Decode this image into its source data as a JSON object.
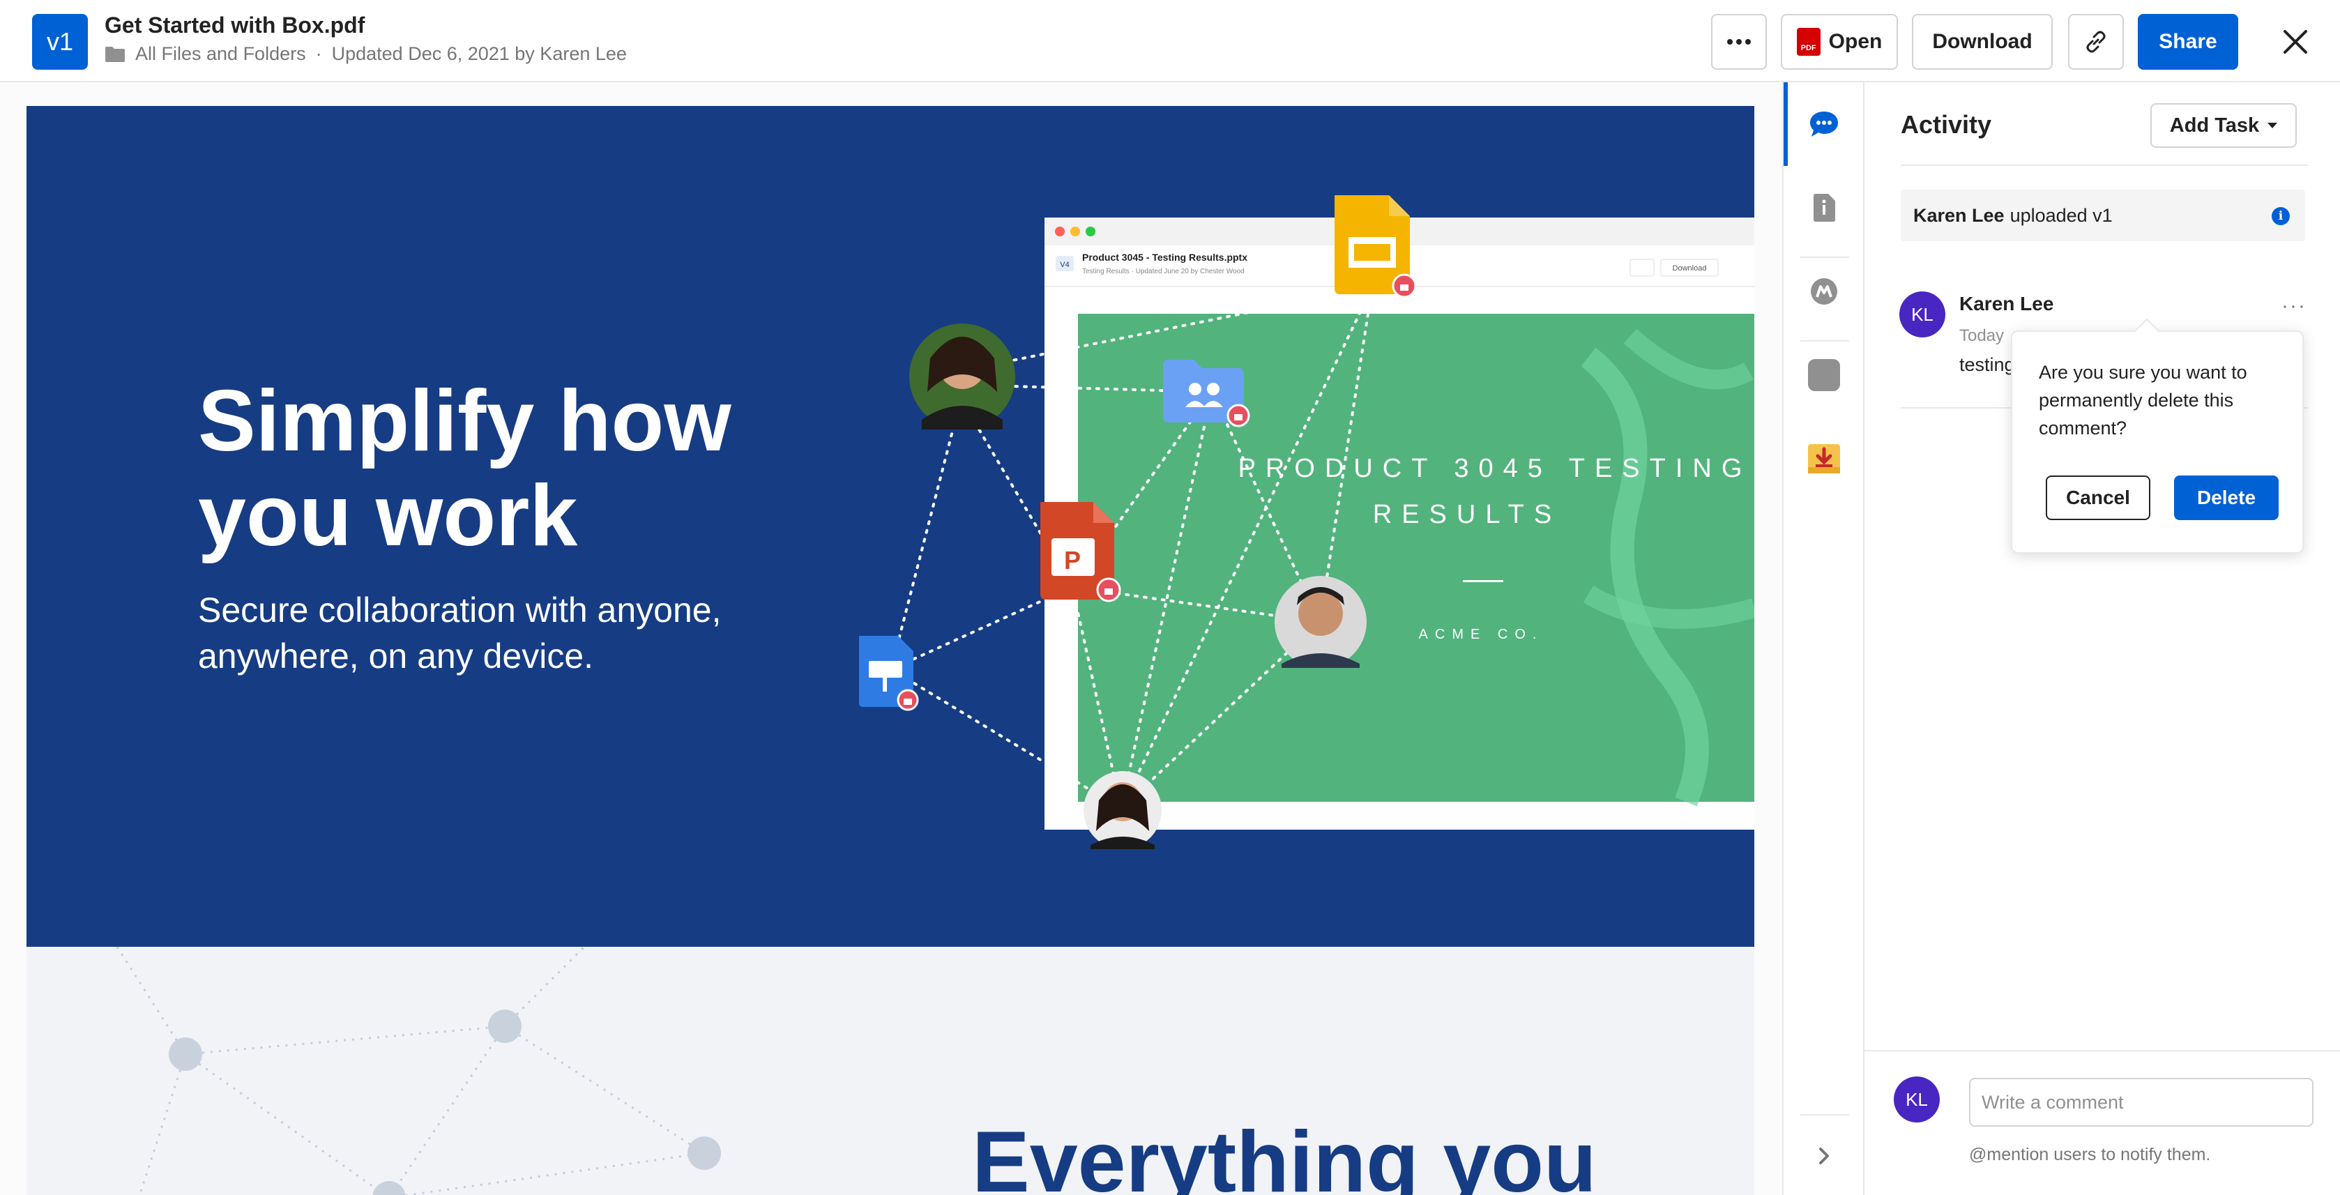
{
  "header": {
    "version_badge": "v1",
    "file_name": "Get Started with Box.pdf",
    "breadcrumb": "All Files and Folders",
    "meta_separator": "·",
    "updated_text": "Updated Dec 6, 2021 by Karen Lee",
    "more_icon": "more-horizontal-icon",
    "open_label": "Open",
    "pdf_badge": "PDF",
    "download_label": "Download",
    "link_icon": "link-icon",
    "share_label": "Share",
    "close_icon": "close-icon"
  },
  "document": {
    "headline_line1": "Simplify how",
    "headline_line2": "you work",
    "subhead_line1": "Secure collaboration with anyone,",
    "subhead_line2": "anywhere, on any device.",
    "mock_version": "V4",
    "mock_file_title": "Product 3045 - Testing Results.pptx",
    "mock_file_meta": "Testing Results · Updated June 20 by Chester Wood",
    "mock_download": "Download",
    "slide_title_line1": "PRODUCT 3045 TESTING",
    "slide_title_line2": "RESULTS",
    "slide_company": "ACME CO.",
    "ppt_icon_letter": "P",
    "section2_heading": "Everything you"
  },
  "sidebar": {
    "items": [
      {
        "icon": "comment-bubble-icon",
        "active": true
      },
      {
        "icon": "file-info-icon",
        "active": false
      },
      {
        "icon": "skills-icon",
        "active": false
      },
      {
        "icon": "metadata-icon",
        "active": false
      },
      {
        "icon": "download-box-icon",
        "active": false
      }
    ],
    "expand_icon": "chevron-right-icon"
  },
  "activity": {
    "title": "Activity",
    "add_task_label": "Add Task",
    "upload_user": "Karen Lee",
    "upload_action": "uploaded v1",
    "comment": {
      "avatar_initials": "KL",
      "author": "Karen Lee",
      "time": "Today",
      "text": "testing",
      "more": "···"
    },
    "confirm": {
      "message": "Are you sure you want to permanently delete this comment?",
      "cancel_label": "Cancel",
      "delete_label": "Delete"
    },
    "composer": {
      "avatar_initials": "KL",
      "placeholder": "Write a comment",
      "hint": "@mention users to notify them."
    }
  },
  "colors": {
    "brand_blue": "#0061d5",
    "hero_navy": "#163c83",
    "slide_green": "#4caf72",
    "avatar_purple": "#4826c2",
    "pdf_red": "#d50000",
    "ppt_orange": "#d24726",
    "slides_yellow": "#f4b400",
    "keynote_blue": "#2f7be4"
  }
}
